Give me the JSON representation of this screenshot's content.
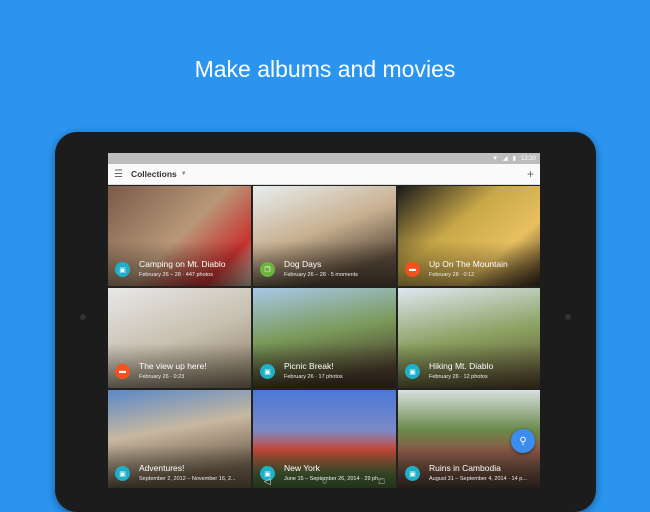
{
  "headline": "Make albums and movies",
  "status": {
    "time": "12:30"
  },
  "toolbar": {
    "title": "Collections"
  },
  "tiles": [
    {
      "name": "Camping on Mt. Diablo",
      "meta": "February 26 – 28 · 447 photos",
      "type": "album",
      "color": "#1eb0c8"
    },
    {
      "name": "Dog Days",
      "meta": "February 26 – 28 · 5 moments",
      "type": "story",
      "color": "#6db33f"
    },
    {
      "name": "Up On The Mountain",
      "meta": "February 28 · 0:12",
      "type": "movie",
      "color": "#f4511e"
    },
    {
      "name": "The view up here!",
      "meta": "February 26 · 0:23",
      "type": "movie",
      "color": "#f4511e"
    },
    {
      "name": "Picnic Break!",
      "meta": "February 26 · 17 photos",
      "type": "album",
      "color": "#1eb0c8"
    },
    {
      "name": "Hiking Mt. Diablo",
      "meta": "February 26 · 12 photos",
      "type": "album",
      "color": "#1eb0c8"
    },
    {
      "name": "Adventures!",
      "meta": "September 2, 2012 – November 16, 2...",
      "type": "album",
      "color": "#1eb0c8"
    },
    {
      "name": "New York",
      "meta": "June 15 – September 26, 2014 · 29 ph...",
      "type": "album",
      "color": "#1eb0c8"
    },
    {
      "name": "Ruins in Cambodia",
      "meta": "August 31 – September 4, 2014 · 14 p...",
      "type": "album",
      "color": "#1eb0c8"
    }
  ]
}
